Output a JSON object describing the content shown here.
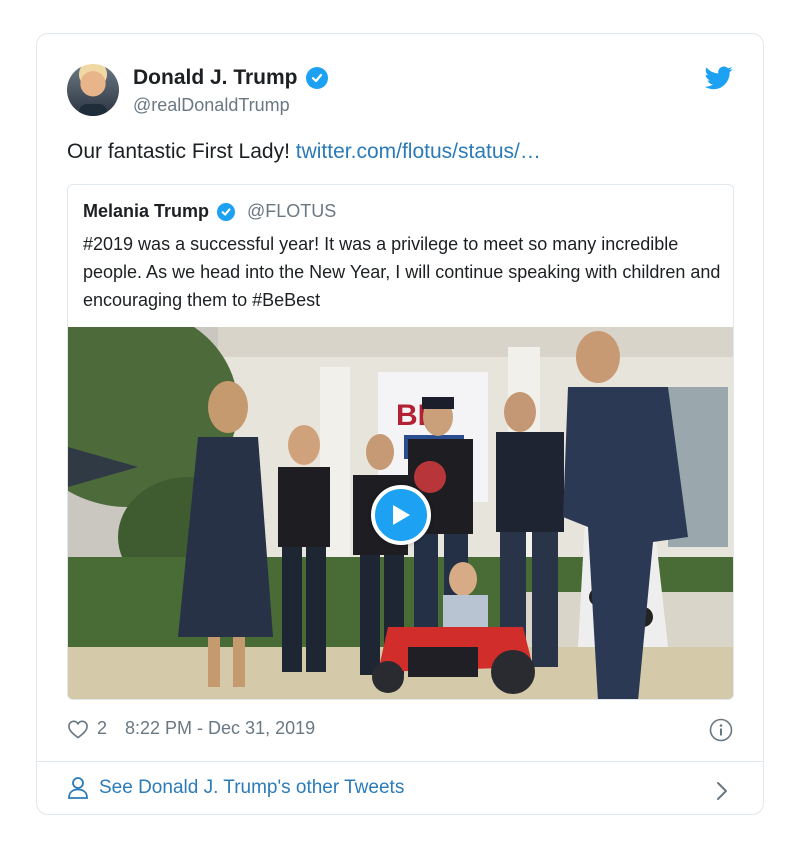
{
  "tweet": {
    "author_name": "Donald J. Trump",
    "handle": "@realDonaldTrump",
    "text": "Our fantastic First Lady!",
    "link_text": "twitter.com/flotus/status/…",
    "likes": "2",
    "timestamp": "8:22 PM - Dec 31, 2019"
  },
  "quoted": {
    "author_name": "Melania Trump",
    "handle": "@FLOTUS",
    "text": "#2019 was a successful year! It was a privilege to meet so many incredible people. As we head into the New Year, I will continue speaking with children and encouraging them to #BeBest",
    "media_sign_text": "BE"
  },
  "footer": {
    "other_tweets_label": "See Donald J. Trump's other Tweets"
  },
  "icons": {
    "verified": "verified-badge-icon",
    "bird": "twitter-bird-icon",
    "play": "play-icon",
    "heart": "heart-icon",
    "info": "info-icon",
    "person": "person-icon",
    "chevron": "chevron-right-icon"
  },
  "colors": {
    "accent": "#1da1f2",
    "link": "#2b7bb9",
    "text": "#1c2022",
    "muted": "#697882",
    "border": "#e1e8ed"
  }
}
